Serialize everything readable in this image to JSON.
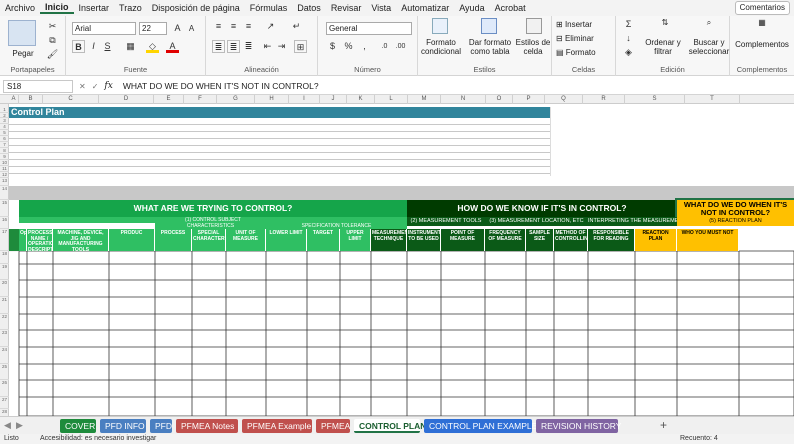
{
  "menu": [
    "Archivo",
    "Inicio",
    "Insertar",
    "Trazo",
    "Disposición de página",
    "Fórmulas",
    "Datos",
    "Revisar",
    "Vista",
    "Automatizar",
    "Ayuda",
    "Acrobat"
  ],
  "comments_label": "Comentarios",
  "ribbon": {
    "paste": "Pegar",
    "font_name": "Arial",
    "font_size": "22",
    "number_format": "General",
    "cond_format": "Formato condicional",
    "table_format": "Dar formato como tabla",
    "cell_styles": "Estilos de celda",
    "insert": "Insertar",
    "delete": "Eliminar",
    "format": "Formato",
    "sort_filter": "Ordenar y filtrar",
    "find_select": "Buscar y seleccionar",
    "addins": "Complementos",
    "groups": {
      "clipboard": "Portapapeles",
      "font": "Fuente",
      "align": "Alineación",
      "number": "Número",
      "styles": "Estilos",
      "cells": "Celdas",
      "edit": "Edición",
      "addins": "Complementos"
    }
  },
  "formula": {
    "cell": "S18",
    "fx": "fx",
    "value": "WHAT DO WE DO WHEN IT'S NOT IN CONTROL?"
  },
  "columns": [
    "A",
    "B",
    "C",
    "D",
    "E",
    "F",
    "G",
    "H",
    "I",
    "J",
    "K",
    "L",
    "M",
    "N",
    "O",
    "P",
    "Q",
    "R",
    "S",
    "T"
  ],
  "rows": [
    "1",
    "2",
    "3",
    "4",
    "5",
    "6",
    "7",
    "8",
    "9",
    "10",
    "11",
    "12",
    "13",
    "14",
    "15",
    "16",
    "17",
    "18",
    "19",
    "20",
    "21",
    "22",
    "23",
    "24",
    "25",
    "26",
    "27",
    "28"
  ],
  "sheet": {
    "title": "Control Plan",
    "s1": "WHAT ARE WE TRYING TO CONTROL?",
    "s2": "HOW DO WE KNOW IF IT'S IN CONTROL?",
    "s3": "WHAT DO WE DO WHEN IT'S NOT IN CONTROL?",
    "sub1": "(1) CONTROL SUBJECT",
    "sub2a": "(2) MEASUREMENT TOOLS",
    "sub2b": "(3) MEASUREMENT LOCATION, ETC",
    "sub2c": "INTERPRETING THE MEASUREME",
    "sub3": "(5) REACTION PLAN",
    "char": "CHARACTERISTICS",
    "spec": "SPECIFICATION TOLERANCE",
    "headers": [
      "Oper",
      "PROCESS NAME / OPERATION DESCRIPTION",
      "MACHINE, DEVICE, JIG AND MANUFACTURING TOOLS",
      "PRODUC",
      "PROCESS",
      "SPECIAL CHARACTERISTIC",
      "UNIT OF MEASURE",
      "LOWER LIMIT",
      "TARGET",
      "UPPER LIMIT",
      "MEASUREMENT TECHNIQUE",
      "INSTRUMENT TO BE USED",
      "POINT OF MEASURE",
      "FREQUENCY OF MEASURE",
      "SAMPLE SIZE",
      "METHOD OF CONTROLLING",
      "RESPONSIBLE FOR READING",
      "REACTION PLAN",
      "WHO YOU MUST NOT"
    ]
  },
  "tabs": [
    {
      "label": "COVER",
      "color": "#1e8b3c"
    },
    {
      "label": "PFD INFO",
      "color": "#4a7fc1"
    },
    {
      "label": "PFD",
      "color": "#4a7fc1"
    },
    {
      "label": "PFMEA Notes",
      "color": "#c0504d"
    },
    {
      "label": "PFMEA Example",
      "color": "#c0504d"
    },
    {
      "label": "PFMEA",
      "color": "#c0504d"
    },
    {
      "label": "CONTROL PLAN",
      "color": "#ffffff"
    },
    {
      "label": "CONTROL PLAN EXAMPLE",
      "color": "#2f6fd6"
    },
    {
      "label": "REVISION HISTORY",
      "color": "#8064a2"
    }
  ],
  "status": {
    "left": "Listo",
    "access": "Accesibilidad: es necesario investigar",
    "count": "Recuento: 4"
  }
}
